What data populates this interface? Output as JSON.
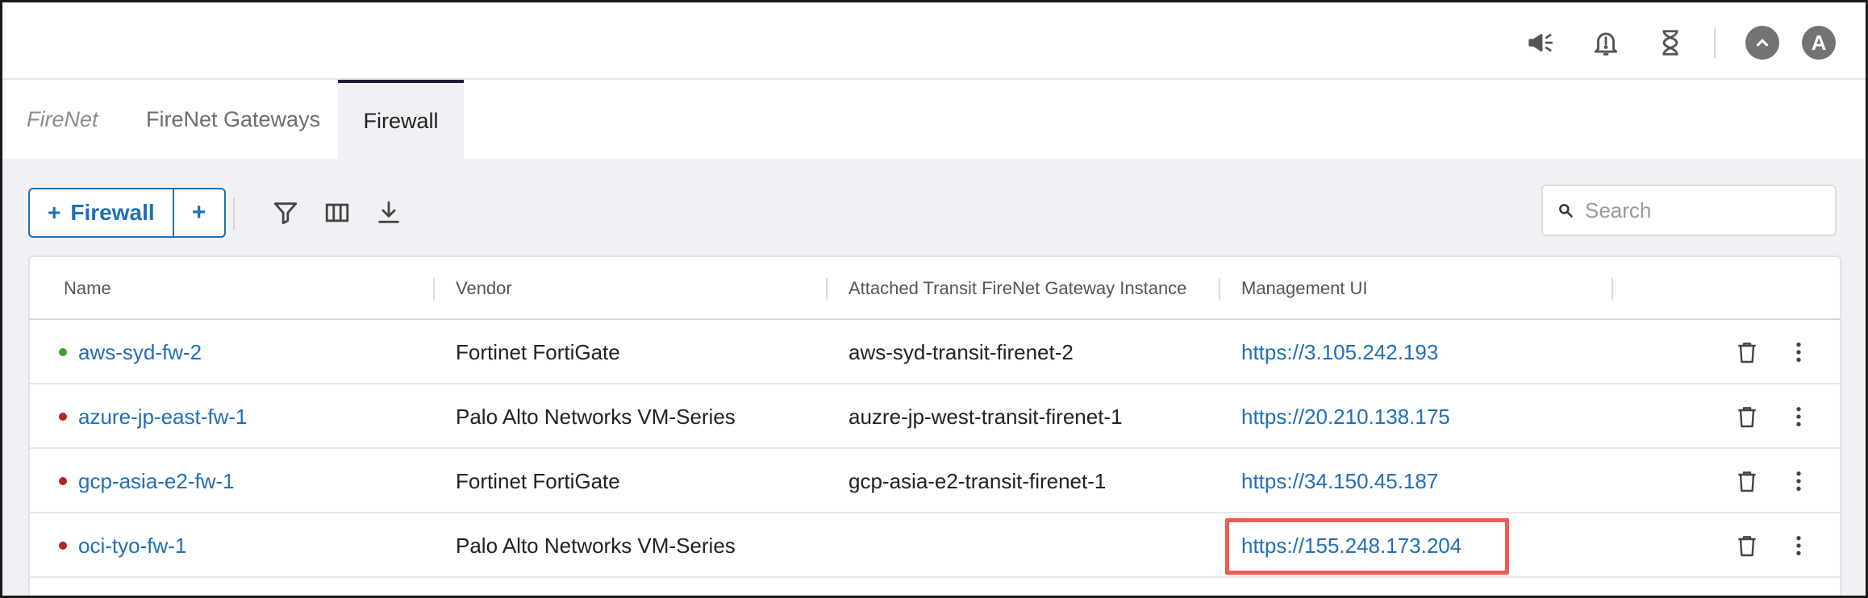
{
  "tabs": [
    {
      "label": "FireNet"
    },
    {
      "label": "FireNet Gateways"
    },
    {
      "label": "Firewall",
      "active": true
    }
  ],
  "toolbar": {
    "add_label": "Firewall",
    "add_plus": "+",
    "extra_plus": "+"
  },
  "search": {
    "placeholder": "Search"
  },
  "user": {
    "avatar_initial": "A"
  },
  "table": {
    "columns": [
      "Name",
      "Vendor",
      "Attached Transit FireNet Gateway Instance",
      "Management UI"
    ],
    "rows": [
      {
        "name": "aws-syd-fw-2",
        "status": "green",
        "vendor": "Fortinet FortiGate",
        "gateway": "aws-syd-transit-firenet-2",
        "mgmt": "https://3.105.242.193"
      },
      {
        "name": "azure-jp-east-fw-1",
        "status": "red",
        "vendor": "Palo Alto Networks VM-Series",
        "gateway": "auzre-jp-west-transit-firenet-1",
        "mgmt": "https://20.210.138.175"
      },
      {
        "name": "gcp-asia-e2-fw-1",
        "status": "red",
        "vendor": "Fortinet FortiGate",
        "gateway": "gcp-asia-e2-transit-firenet-1",
        "mgmt": "https://34.150.45.187"
      },
      {
        "name": "oci-tyo-fw-1",
        "status": "red",
        "vendor": "Palo Alto Networks VM-Series",
        "gateway": "",
        "mgmt": "https://155.248.173.204"
      }
    ]
  },
  "colors": {
    "accent": "#1f6fb8",
    "status_green": "#4a9a2e",
    "status_red": "#b3261e",
    "highlight": "#ef5d4e"
  }
}
